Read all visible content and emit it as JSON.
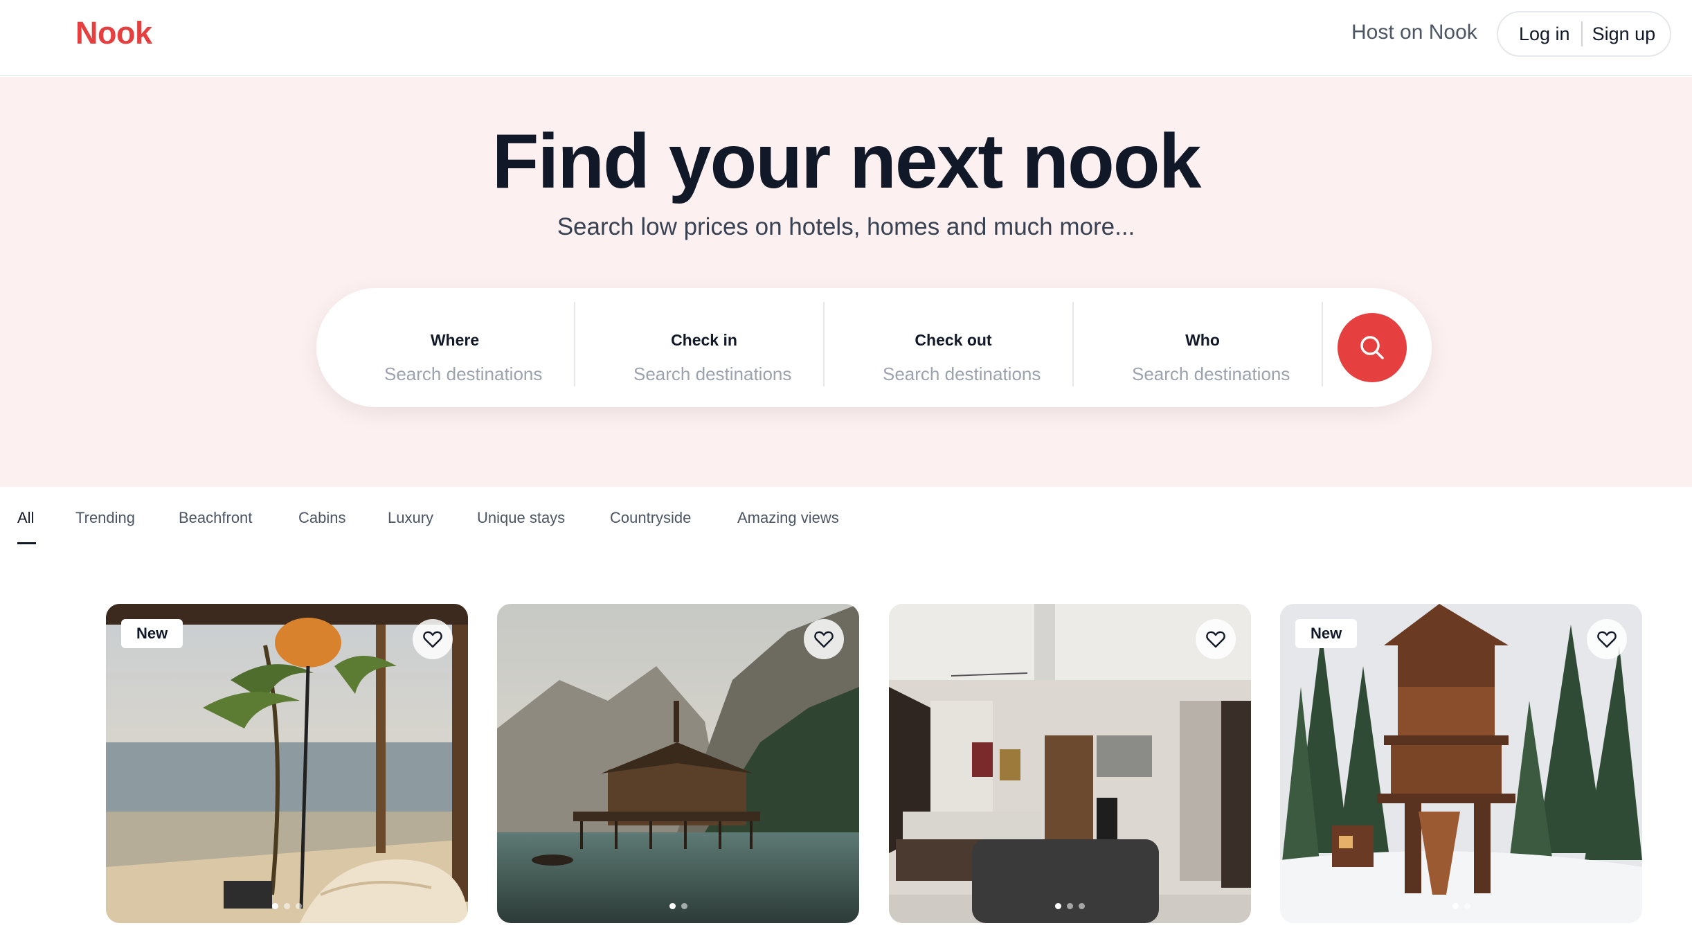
{
  "header": {
    "logo": "Nook",
    "host_link": "Host on Nook",
    "login": "Log in",
    "signup": "Sign up"
  },
  "hero": {
    "title": "Find your next nook",
    "subtitle": "Search low prices on hotels, homes and much more..."
  },
  "search": {
    "fields": [
      {
        "label": "Where",
        "placeholder": "Search destinations"
      },
      {
        "label": "Check in",
        "placeholder": "Search destinations"
      },
      {
        "label": "Check out",
        "placeholder": "Search destinations"
      },
      {
        "label": "Who",
        "placeholder": "Search destinations"
      }
    ],
    "button_icon": "search-icon"
  },
  "tabs": {
    "active": "All",
    "items": [
      "All",
      "Trending",
      "Beachfront",
      "Cabins",
      "Luxury",
      "Unique stays",
      "Countryside",
      "Amazing views"
    ]
  },
  "listings": [
    {
      "badge": "New",
      "photo": "beachfront bedroom with palm trees and ocean view",
      "dots": 3,
      "active_dot": 1
    },
    {
      "badge": "",
      "photo": "wooden lake house on stilts beneath mountains",
      "dots": 2,
      "active_dot": 1
    },
    {
      "badge": "",
      "photo": "modern bedroom interior with sofa and desk",
      "dots": 3,
      "active_dot": 1
    },
    {
      "badge": "New",
      "photo": "multi-level treehouse in snowy pine forest",
      "dots": 2,
      "active_dot": 1
    }
  ],
  "colors": {
    "brand": "#e5403f",
    "hero_bg": "#fdf0f1",
    "text": "#111827",
    "muted": "#9ca3af"
  }
}
